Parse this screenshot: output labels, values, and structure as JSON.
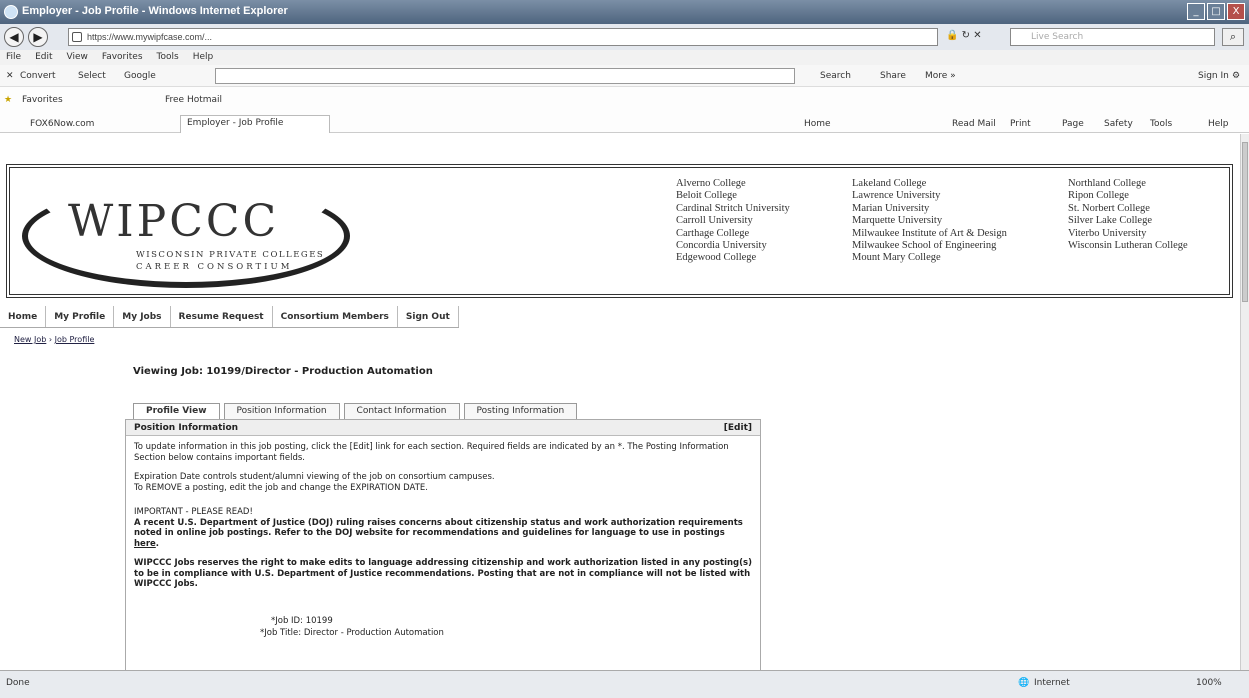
{
  "window": {
    "title": "Employer - Job Profile - Windows Internet Explorer",
    "buttons": [
      "_",
      "□",
      "X"
    ]
  },
  "addressbar": {
    "back_icon": "back-arrow-icon",
    "forward_icon": "forward-arrow-icon",
    "url": "https://www.mywipfcase.com/...",
    "search_placeholder": "Live Search"
  },
  "menubar": [
    "File",
    "Edit",
    "View",
    "Favorites",
    "Tools",
    "Help"
  ],
  "google_toolbar": {
    "convert": "Convert",
    "select": "Select",
    "google": "Google",
    "search": "Search",
    "share": "Share",
    "more": "More »",
    "sign_in": "Sign In"
  },
  "favorites_bar": {
    "favorites": "Favorites",
    "free_hotmail": "Free Hotmail",
    "foxnow": "FOX6Now.com",
    "tab_title": "Employer - Job Profile",
    "home": "Home",
    "read_mail": "Read Mail",
    "print": "Print",
    "page": "Page",
    "safety": "Safety",
    "tools": "Tools",
    "help": "Help"
  },
  "banner": {
    "logo_big": "WIPCCC",
    "logo_line1": "WISCONSIN PRIVATE COLLEGES",
    "logo_line2": "CAREER CONSORTIUM",
    "col1": [
      "Alverno College",
      "Beloit College",
      "Cardinal Stritch University",
      "Carroll University",
      "Carthage College",
      "Concordia University",
      "Edgewood College"
    ],
    "col2": [
      "Lakeland College",
      "Lawrence University",
      "Marian University",
      "Marquette University",
      "Milwaukee Institute of Art & Design",
      "Milwaukee School of Engineering",
      "Mount Mary College"
    ],
    "col3": [
      "Northland College",
      "Ripon College",
      "St. Norbert College",
      "Silver Lake College",
      "Viterbo University",
      "Wisconsin Lutheran College"
    ]
  },
  "nav": [
    "Home",
    "My Profile",
    "My Jobs",
    "Resume Request",
    "Consortium Members",
    "Sign Out"
  ],
  "breadcrumb": {
    "item1": "New Job",
    "sep": " › ",
    "item2": "Job Profile"
  },
  "job": {
    "viewing_title": "Viewing Job: 10199/Director - Production Automation",
    "tabs": [
      "Profile View",
      "Position Information",
      "Contact Information",
      "Posting Information"
    ],
    "panel_title": "Position Information",
    "edit_label": "[Edit]",
    "p1": "To update information in this job posting, click the [Edit] link for each section. Required fields are indicated by an *. The Posting Information Section below contains important fields.",
    "p2a": "Expiration Date controls student/alumni viewing of the job on consortium campuses.",
    "p2b": "To REMOVE a posting, edit the job and change the EXPIRATION DATE.",
    "important_heading": "IMPORTANT - PLEASE READ!",
    "p3": "A recent U.S. Department of Justice (DOJ) ruling raises concerns about citizenship status and work authorization requirements noted in online job postings. Refer to the DOJ website for recommendations and guidelines for language to use in postings",
    "here": "here",
    "p4": "WIPCCC Jobs reserves the right to make edits to language addressing citizenship and work authorization listed in any posting(s) to be in compliance with U.S. Department of Justice recommendations. Posting that are not in compliance will not be listed with WIPCCC Jobs.",
    "job_id_label": "*Job ID:",
    "job_id_value": "10199",
    "job_title_label": "*Job Title:",
    "job_title_value": "Director - Production Automation"
  },
  "statusbar": {
    "done": "Done",
    "zone": "Internet",
    "zoom": "100%"
  }
}
